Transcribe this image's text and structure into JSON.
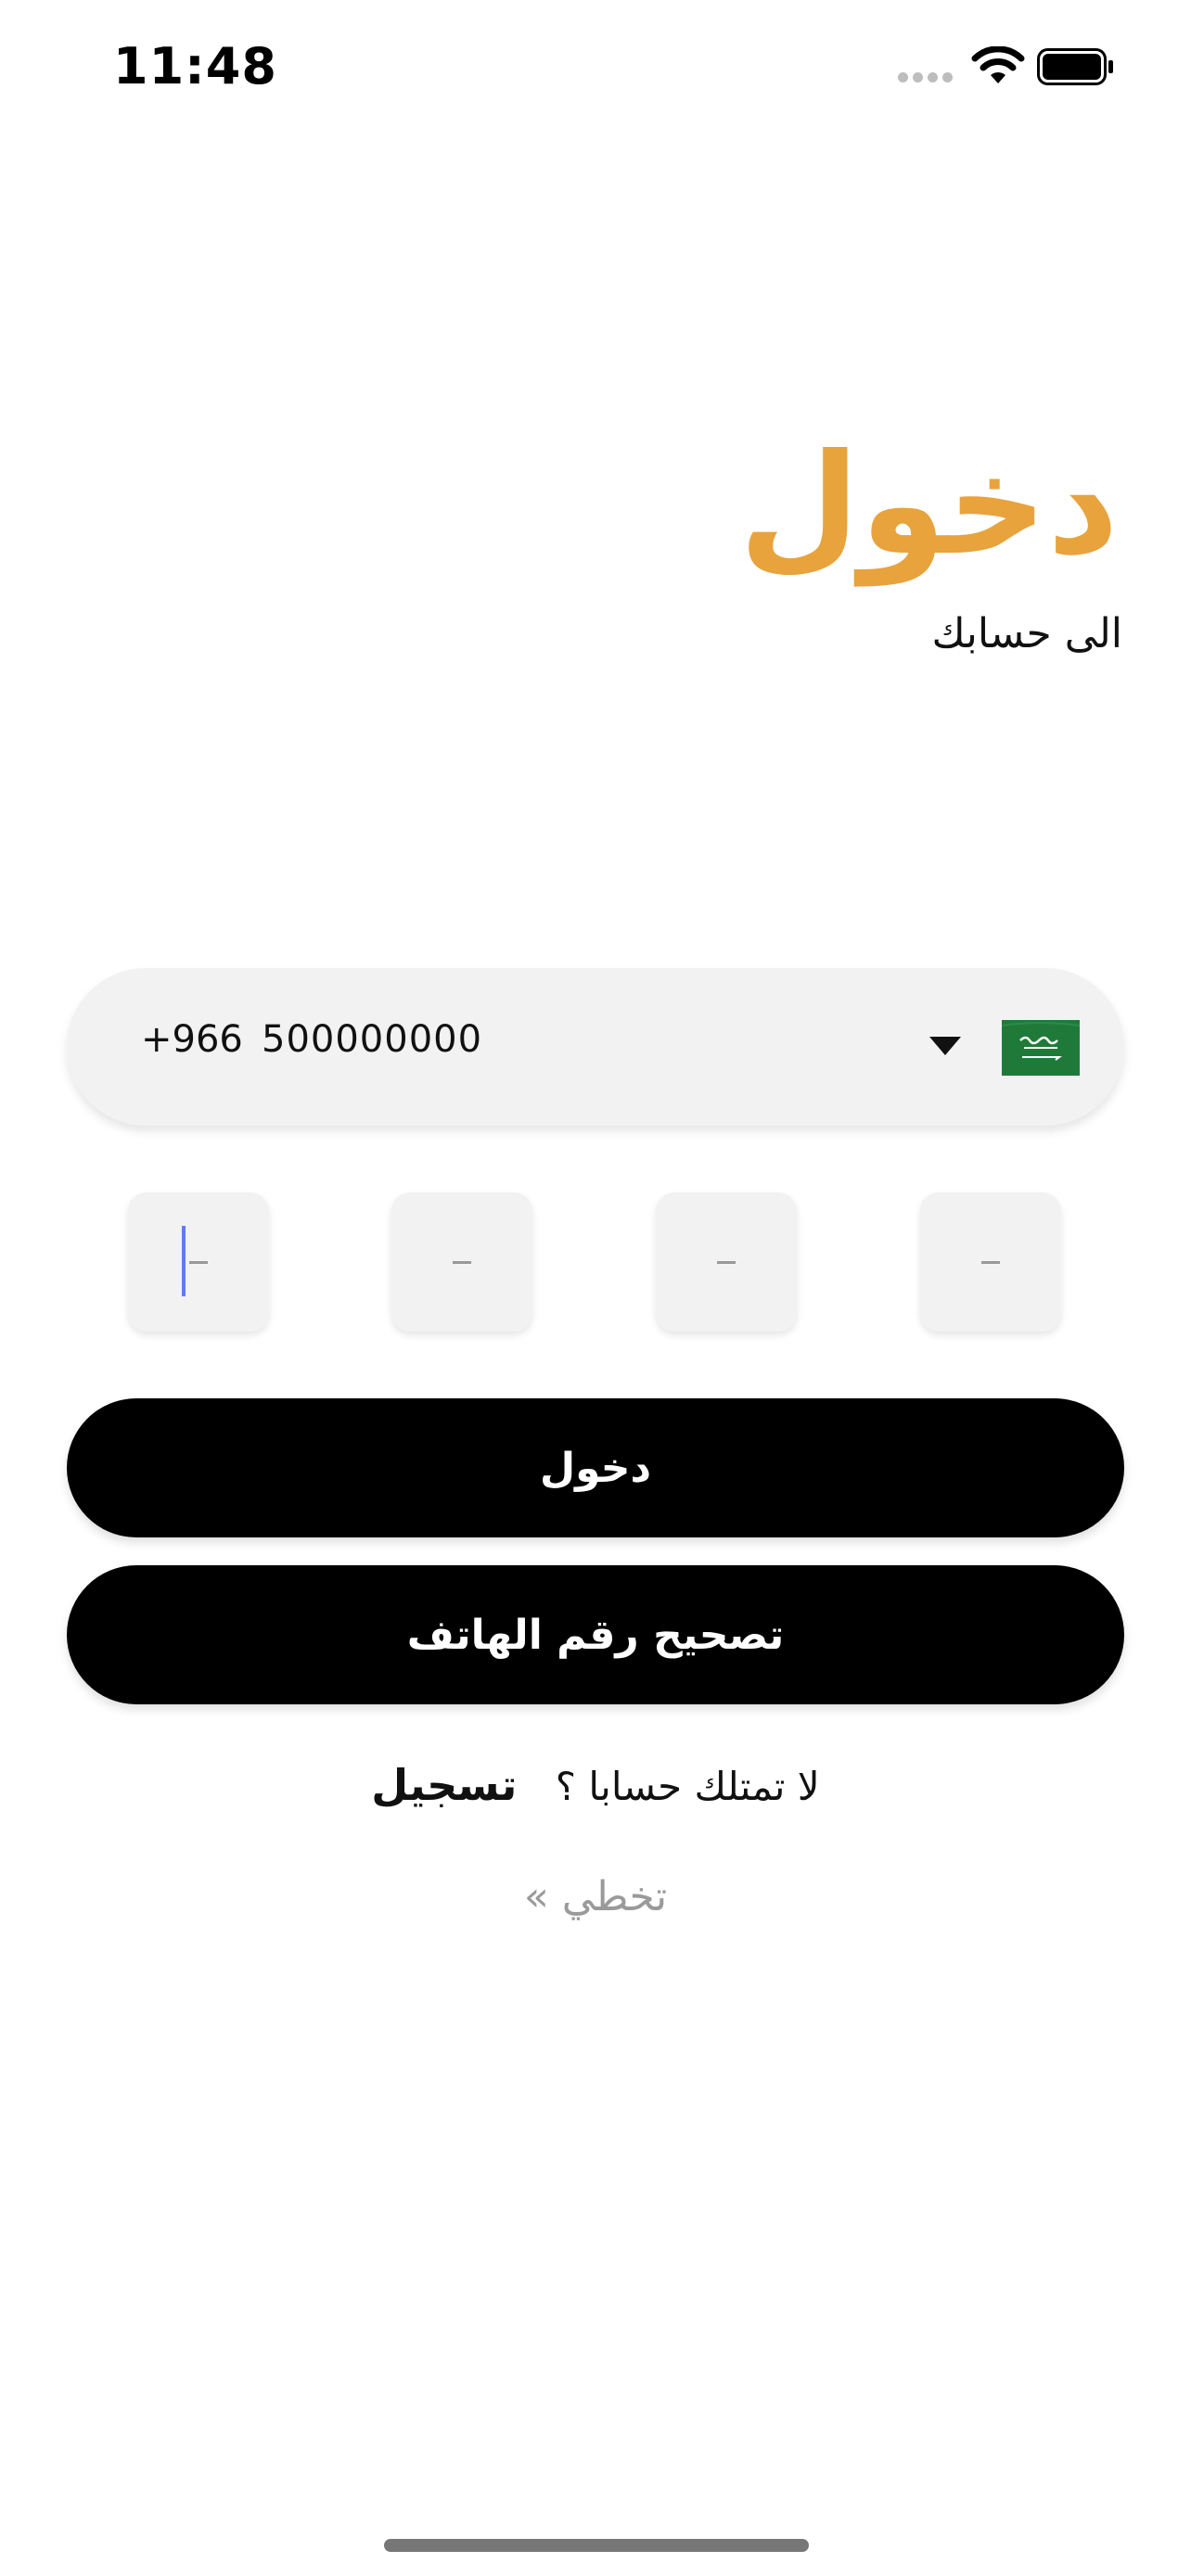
{
  "status_bar": {
    "time": "11:48"
  },
  "header": {
    "title": "دخول",
    "subtitle": "الى حسابك"
  },
  "phone_input": {
    "dial_code": "+966",
    "number": "500000000",
    "country": "Saudi Arabia"
  },
  "otp": {
    "placeholder": "-",
    "digits": [
      "",
      "",
      "",
      ""
    ]
  },
  "buttons": {
    "login": "دخول",
    "correct_phone": "تصحيح رقم الهاتف"
  },
  "register": {
    "question": "لا تمتلك حسابا ؟",
    "link": "تسجيل"
  },
  "skip": {
    "label": "تخطي »"
  },
  "colors": {
    "accent": "#E8A33D",
    "button": "#000000",
    "field_bg": "#f2f2f2",
    "caret": "#5f7cf2"
  }
}
